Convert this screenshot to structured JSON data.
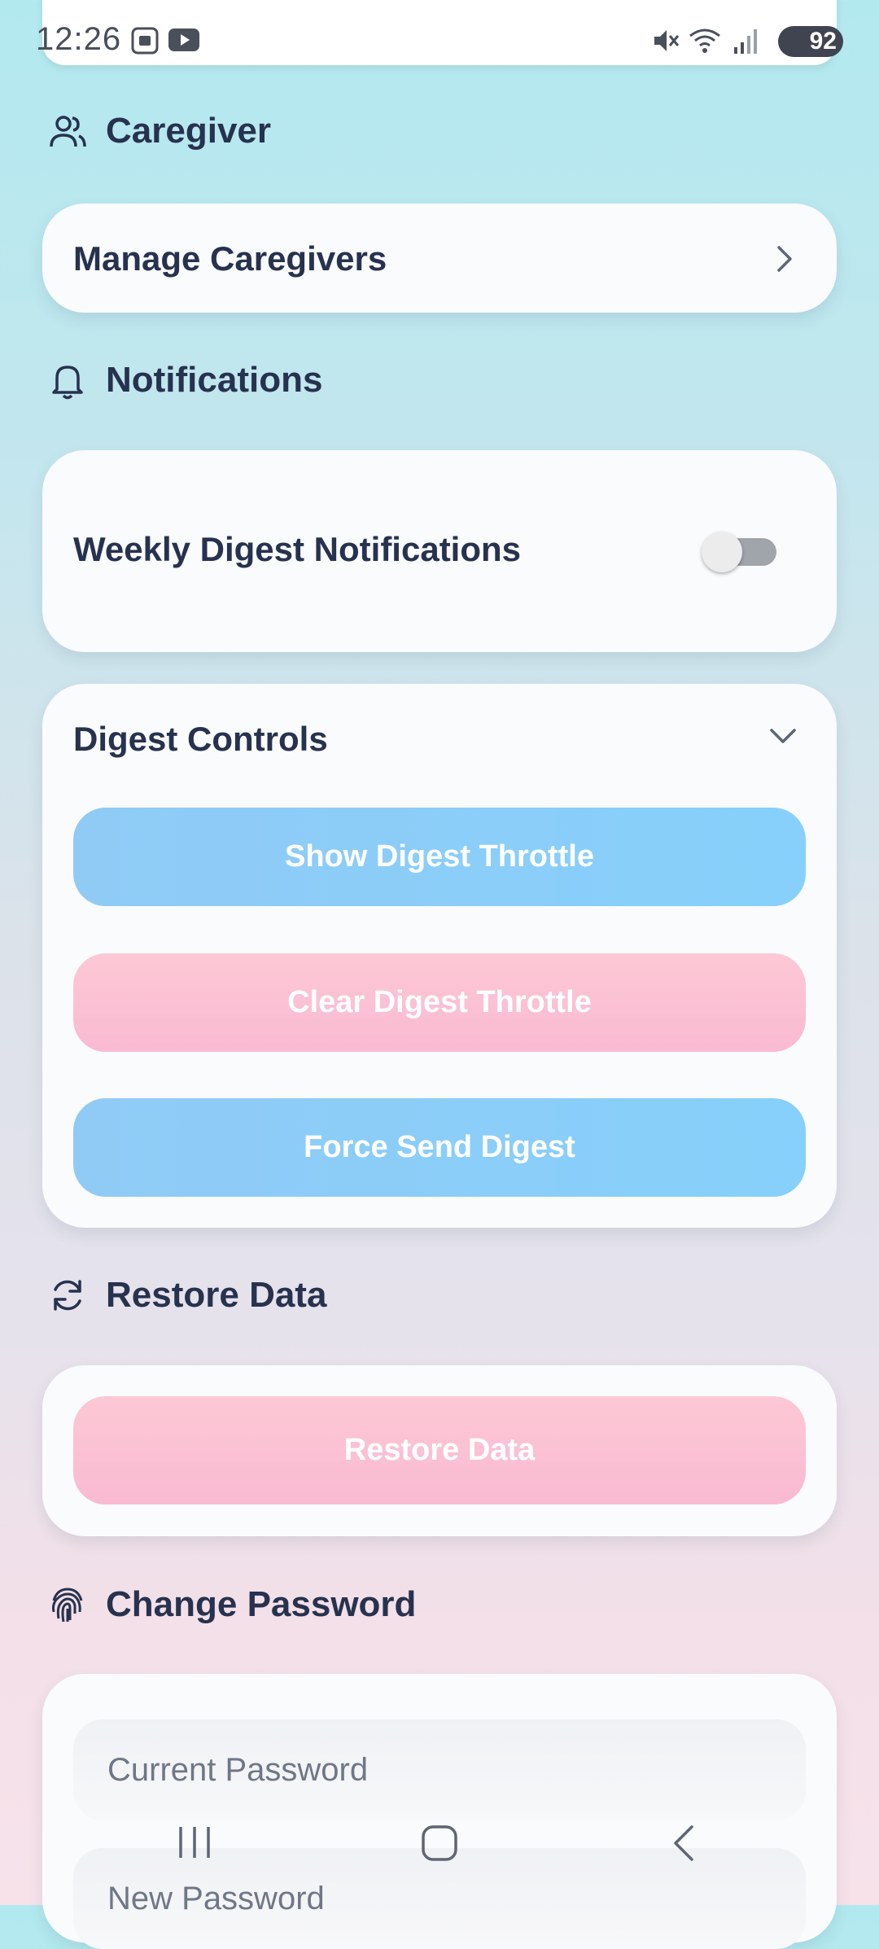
{
  "status_bar": {
    "time": "12:26",
    "battery": "92"
  },
  "sections": {
    "caregiver": {
      "title": "Caregiver",
      "icon": "users-icon"
    },
    "notifications": {
      "title": "Notifications",
      "icon": "bell-icon"
    },
    "restore": {
      "title": "Restore Data",
      "icon": "refresh-icon"
    },
    "password": {
      "title": "Change Password",
      "icon": "fingerprint-icon"
    }
  },
  "caregiver_card": {
    "manage_label": "Manage Caregivers"
  },
  "notifications_card": {
    "weekly_digest_label": "Weekly Digest Notifications",
    "weekly_digest_enabled": false
  },
  "digest_controls": {
    "title": "Digest Controls",
    "show_throttle_label": "Show Digest Throttle",
    "clear_throttle_label": "Clear Digest Throttle",
    "force_send_label": "Force Send Digest"
  },
  "restore_card": {
    "button_label": "Restore Data"
  },
  "password_card": {
    "current_placeholder": "Current Password",
    "new_placeholder": "New Password"
  },
  "colors": {
    "accent_blue": "#8ccdf8",
    "accent_pink": "#fbc1d4",
    "text_dark": "#27324f"
  }
}
